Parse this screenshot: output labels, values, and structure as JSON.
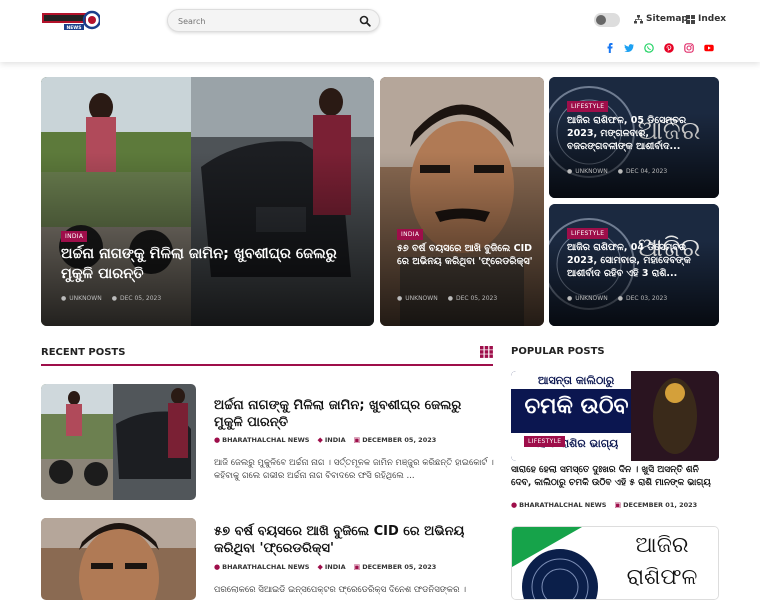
{
  "header": {
    "logo_text": "NEWS",
    "search_placeholder": "Search",
    "sitemap_label": "Sitemap",
    "index_label": "Index"
  },
  "featured": [
    {
      "category": "INDIA",
      "title": "ଅର୍ଚ୍ଚନା ନାଗଙ୍କୁ ମିଳିଲା ଜାମିନ; ଖୁବଶୀଘ୍ର ଜେଲରୁ ମୁକୁଳି ପାରନ୍ତି",
      "author": "UNKNOWN",
      "date": "DEC 05, 2023"
    },
    {
      "category": "INDIA",
      "title": "୫୭ ବର୍ଷ ବୟସରେ ଆଖି ବୁଜିଲେ CID ରେ ଅଭିନୟ କରିଥିବା 'ଫ୍ରେଡରିକ୍ସ'",
      "author": "UNKNOWN",
      "date": "DEC 05, 2023"
    },
    {
      "category": "LIFESTYLE",
      "title": "ଆଜିର ରାଶିଫଳ, 05 ଡିସେମ୍ବର 2023, ମଙ୍ଗଳବାର, ବଜରଙ୍ଗବଳୀଙ୍କ ଆଶୀର୍ବାଦ...",
      "author": "UNKNOWN",
      "date": "DEC 04, 2023"
    },
    {
      "category": "LIFESTYLE",
      "title": "ଆଜିର ରାଶିଫଳ, 04 ଡିସେମ୍ବର 2023, ସୋମବାର, ମହାଦେବଙ୍କ ଆଶୀର୍ବାଦ ରହିବ ଏହି 3 ରାଶି...",
      "author": "UNKNOWN",
      "date": "DEC 03, 2023"
    }
  ],
  "recent": {
    "heading": "RECENT POSTS",
    "posts": [
      {
        "title": "ଅର୍ଚ୍ଚନା ନାଗଙ୍କୁ ମିଳିଲା ଜାମିନ; ଖୁବଶୀଘ୍ର ଜେଲରୁ ମୁକୁଳି ପାରନ୍ତି",
        "author": "BHARATHALCHAL NEWS",
        "category": "INDIA",
        "date": "DECEMBER 05, 2023",
        "excerpt": "ଆଜି ଜେଲରୁ ମୁକୁଳିବେ ଅର୍ଚ୍ଚନା ନାଗ । ସର୍ତ୍ତମୂଳକ ଜାମିନ ମଞ୍ଜୁର କରିଛନ୍ତି ହାଇକୋର୍ଟ । କହିବାକୁ ଗଲେ ଗଭୀର ଅର୍ଚ୍ଚନା ନାଗ ବିବାଦରେ ଫସି ରହିଥିଲେ ..."
      },
      {
        "title": "୫୭ ବର୍ଷ ବୟସରେ ଆଖି ବୁଜିଲେ CID ରେ ଅଭିନୟ କରିଥିବା 'ଫ୍ରେଡରିକ୍ସ'",
        "author": "BHARATHALCHAL NEWS",
        "category": "INDIA",
        "date": "DECEMBER 05, 2023",
        "excerpt": "ପରଲୋକରେ ସିଆଇଡି ଇନ୍ସପେକ୍ଟର ଫ୍ରେଡେରିକ୍ସ ଦିନେଶ ଫଡନିସଙ୍କର ।"
      }
    ]
  },
  "popular": {
    "heading": "POPULAR POSTS",
    "posts": [
      {
        "image_text_1": "ଆସନ୍ତା କାଲିଠାରୁ",
        "image_text_2": "ଚମକି ଉଠିବ",
        "image_text_3": "ଏହି ୫ ରାଶିର ଭାଗ୍ୟ",
        "category": "LIFESTYLE",
        "title": "ସାରାହେ ହେଲା ସମସ୍ତେ ଦୁଃଖର ଦିନ । ଖୁସି ଅସନ୍ତି ଶନି ଦେବ, କାଲିଠାରୁ ଚମକି ଉଠିବ ଏହି ୫ ରାଶି ମାନଙ୍କ ଭାଗ୍ୟ",
        "author": "BHARATHALCHAL NEWS",
        "date": "DECEMBER 01, 2023"
      },
      {
        "image_text_1": "ଆଜିର",
        "image_text_2": "ରାଶିଫଳ"
      }
    ]
  },
  "colors": {
    "accent": "#9e0e4a",
    "facebook": "#1877f2",
    "twitter": "#1da1f2",
    "whatsapp": "#25d366",
    "pinterest": "#e60023",
    "instagram": "#e1306c",
    "youtube": "#ff0000"
  },
  "icons": [
    "search-icon",
    "moon-icon",
    "sitemap-icon",
    "index-icon",
    "facebook-icon",
    "twitter-icon",
    "whatsapp-icon",
    "pinterest-icon",
    "instagram-icon",
    "youtube-icon",
    "grid-icon",
    "user-icon",
    "tag-icon",
    "calendar-icon"
  ]
}
